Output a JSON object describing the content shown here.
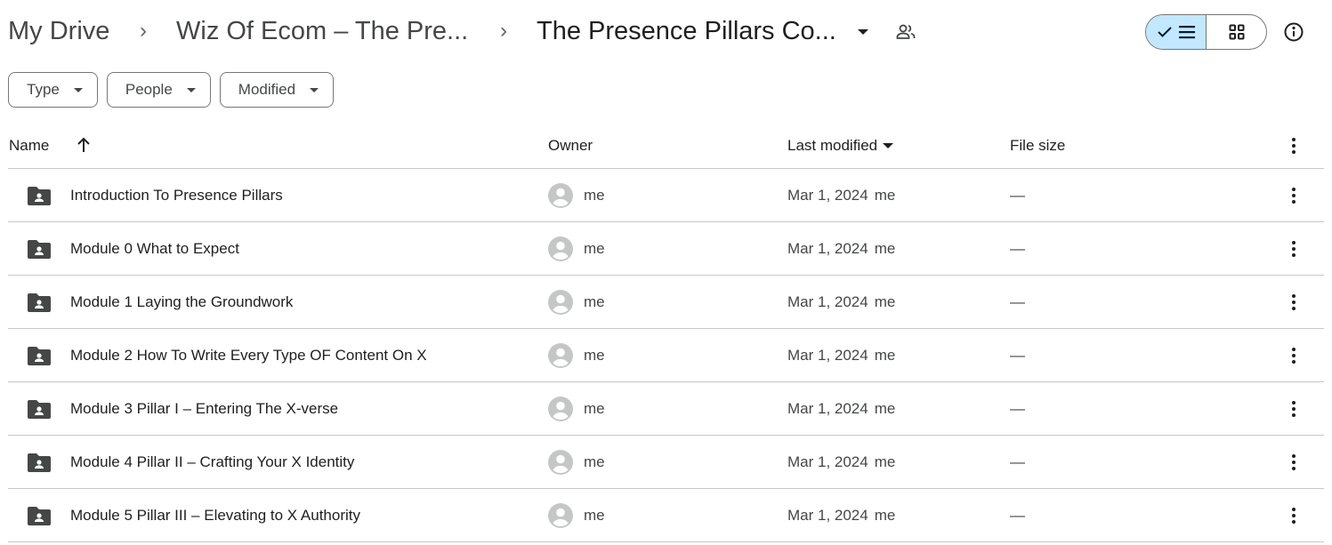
{
  "breadcrumb": {
    "items": [
      {
        "label": "My Drive"
      },
      {
        "label": "Wiz Of Ecom – The Pre..."
      },
      {
        "label": "The Presence Pillars Co..."
      }
    ],
    "separator": "›"
  },
  "header": {
    "shared_icon": "people-icon",
    "view_toggle": {
      "list": "list-view",
      "grid": "grid-view",
      "active": "list"
    },
    "info_icon": "info-icon"
  },
  "filters": [
    {
      "label": "Type"
    },
    {
      "label": "People"
    },
    {
      "label": "Modified"
    }
  ],
  "table": {
    "columns": {
      "name": "Name",
      "owner": "Owner",
      "last_modified": "Last modified",
      "file_size": "File size"
    },
    "sort": {
      "column": "Name",
      "direction": "ascending"
    },
    "rows": [
      {
        "name": "Introduction To Presence Pillars",
        "owner": "me",
        "modified": "Mar 1, 2024",
        "modified_by": "me",
        "size": "—"
      },
      {
        "name": "Module 0 What to Expect",
        "owner": "me",
        "modified": "Mar 1, 2024",
        "modified_by": "me",
        "size": "—"
      },
      {
        "name": "Module 1 Laying the Groundwork",
        "owner": "me",
        "modified": "Mar 1, 2024",
        "modified_by": "me",
        "size": "—"
      },
      {
        "name": "Module 2 How To Write Every Type OF Content On X",
        "owner": "me",
        "modified": "Mar 1, 2024",
        "modified_by": "me",
        "size": "—"
      },
      {
        "name": "Module 3 Pillar I – Entering The X-verse",
        "owner": "me",
        "modified": "Mar 1, 2024",
        "modified_by": "me",
        "size": "—"
      },
      {
        "name": "Module 4 Pillar II – Crafting Your X Identity",
        "owner": "me",
        "modified": "Mar 1, 2024",
        "modified_by": "me",
        "size": "—"
      },
      {
        "name": "Module 5 Pillar III – Elevating to X Authority",
        "owner": "me",
        "modified": "Mar 1, 2024",
        "modified_by": "me",
        "size": "—"
      }
    ]
  },
  "colors": {
    "active_toggle": "#c2e7ff",
    "border": "#747775",
    "divider": "#c7c7c7",
    "folder_icon": "#444746",
    "avatar": "#c4c7c5"
  }
}
